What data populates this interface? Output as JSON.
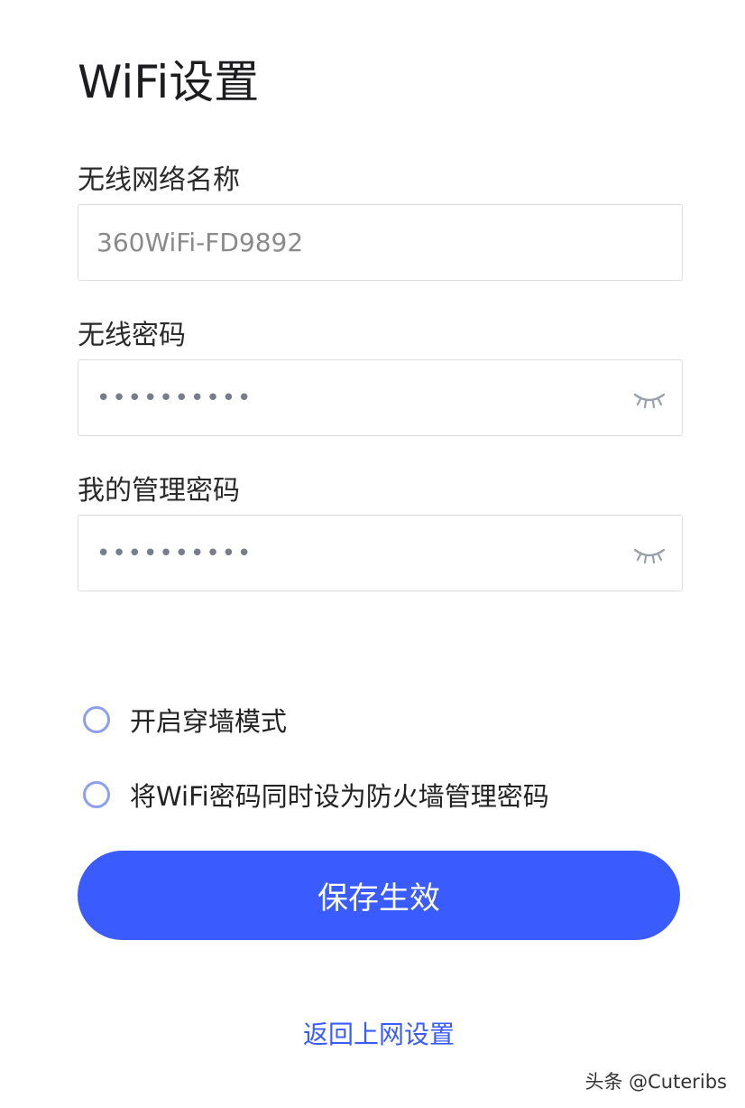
{
  "page": {
    "title": "WiFi设置"
  },
  "form": {
    "ssid": {
      "label": "无线网络名称",
      "value": "360WiFi-FD9892"
    },
    "wifi_password": {
      "label": "无线密码",
      "masked_value": "••••••••••",
      "toggle_icon": "eye-closed-icon"
    },
    "admin_password": {
      "label": "我的管理密码",
      "masked_value": "••••••••••",
      "toggle_icon": "eye-closed-icon"
    }
  },
  "options": [
    {
      "label": "开启穿墙模式",
      "checked": false
    },
    {
      "label": "将WiFi密码同时设为防火墙管理密码",
      "checked": false
    }
  ],
  "actions": {
    "save_label": "保存生效",
    "back_label": "返回上网设置"
  },
  "watermark": {
    "text": "头条 @Cuteribs"
  },
  "colors": {
    "accent": "#3a5cff",
    "radio_border": "#8d9ff0",
    "input_border": "#dedede"
  }
}
